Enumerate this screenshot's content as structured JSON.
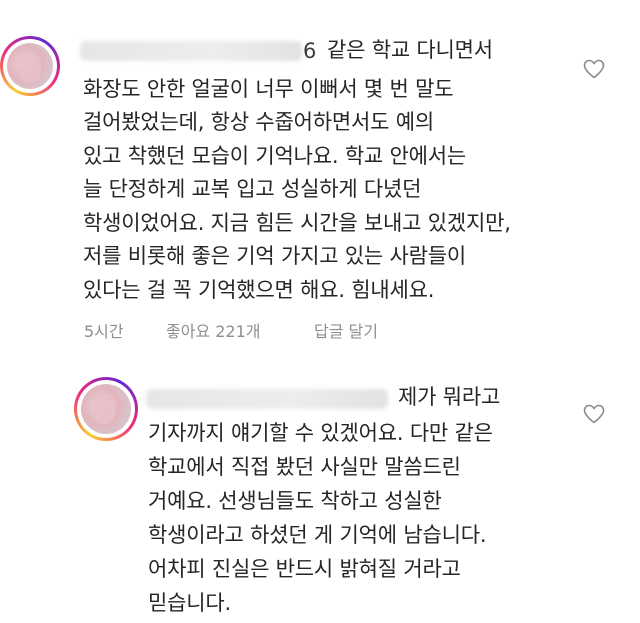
{
  "comments": [
    {
      "username_suffix": "6",
      "lines": [
        "같은 학교 다니면서",
        "화장도 안한 얼굴이 너무 이뻐서 몇 번 말도",
        "걸어봤었는데, 항상 수줍어하면서도 예의",
        "있고 착했던 모습이 기억나요. 학교 안에서는",
        "늘 단정하게 교복 입고 성실하게 다녔던",
        "학생이었어요. 지금 힘든 시간을 보내고 있겠지만,",
        "저를 비롯해 좋은 기억 가지고 있는 사람들이",
        "있다는 걸 꼭 기억했으면 해요. 힘내세요."
      ],
      "time": "5시간",
      "likes": "좋아요 221개",
      "reply": "답글 달기",
      "heart_icon": "heart-outline-icon"
    },
    {
      "lines": [
        "제가 뭐라고",
        "기자까지 얘기할 수 있겠어요. 다만 같은",
        "학교에서 직접 봤던 사실만 말씀드린",
        "거예요. 선생님들도 착하고 성실한",
        "학생이라고 하셨던 게 기억에 남습니다.",
        "어차피 진실은 반드시 밝혀질 거라고",
        "믿습니다."
      ],
      "heart_icon": "heart-outline-icon"
    }
  ],
  "colors": {
    "text": "#262626",
    "meta": "#8e8e8e",
    "story_ring": [
      "#f9ce34",
      "#ee2a7b",
      "#6228d7"
    ]
  }
}
